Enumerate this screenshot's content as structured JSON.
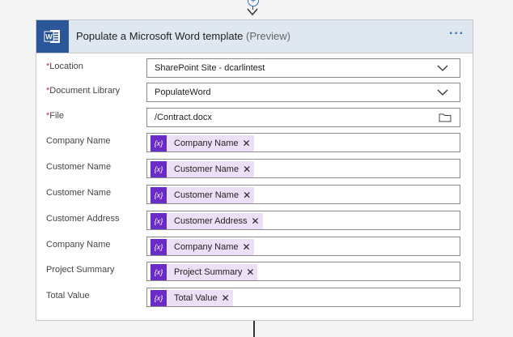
{
  "card": {
    "title": "Populate a Microsoft Word template",
    "preview": "(Preview)",
    "more": "···",
    "icon_letter": "W"
  },
  "fields": [
    {
      "label": "Location",
      "required": true,
      "value": "SharePoint Site - dcarlintest",
      "control": "dropdown"
    },
    {
      "label": "Document Library",
      "required": true,
      "value": "PopulateWord",
      "control": "dropdown"
    },
    {
      "label": "File",
      "required": true,
      "value": "/Contract.docx",
      "control": "file"
    },
    {
      "label": "Company Name",
      "required": false,
      "token": "Company Name",
      "control": "token"
    },
    {
      "label": "Customer Name",
      "required": false,
      "token": "Customer Name",
      "control": "token"
    },
    {
      "label": "Customer Name",
      "required": false,
      "token": "Customer Name",
      "control": "token"
    },
    {
      "label": "Customer Address",
      "required": false,
      "token": "Customer Address",
      "control": "token"
    },
    {
      "label": "Company Name",
      "required": false,
      "token": "Company Name",
      "control": "token"
    },
    {
      "label": "Project Summary",
      "required": false,
      "token": "Project Summary",
      "control": "token"
    },
    {
      "label": "Total Value",
      "required": false,
      "token": "Total Value",
      "control": "token"
    }
  ],
  "token_icon_text": "{x}",
  "required_mark": "*",
  "remove_glyph": "✕",
  "plus_glyph": "+"
}
